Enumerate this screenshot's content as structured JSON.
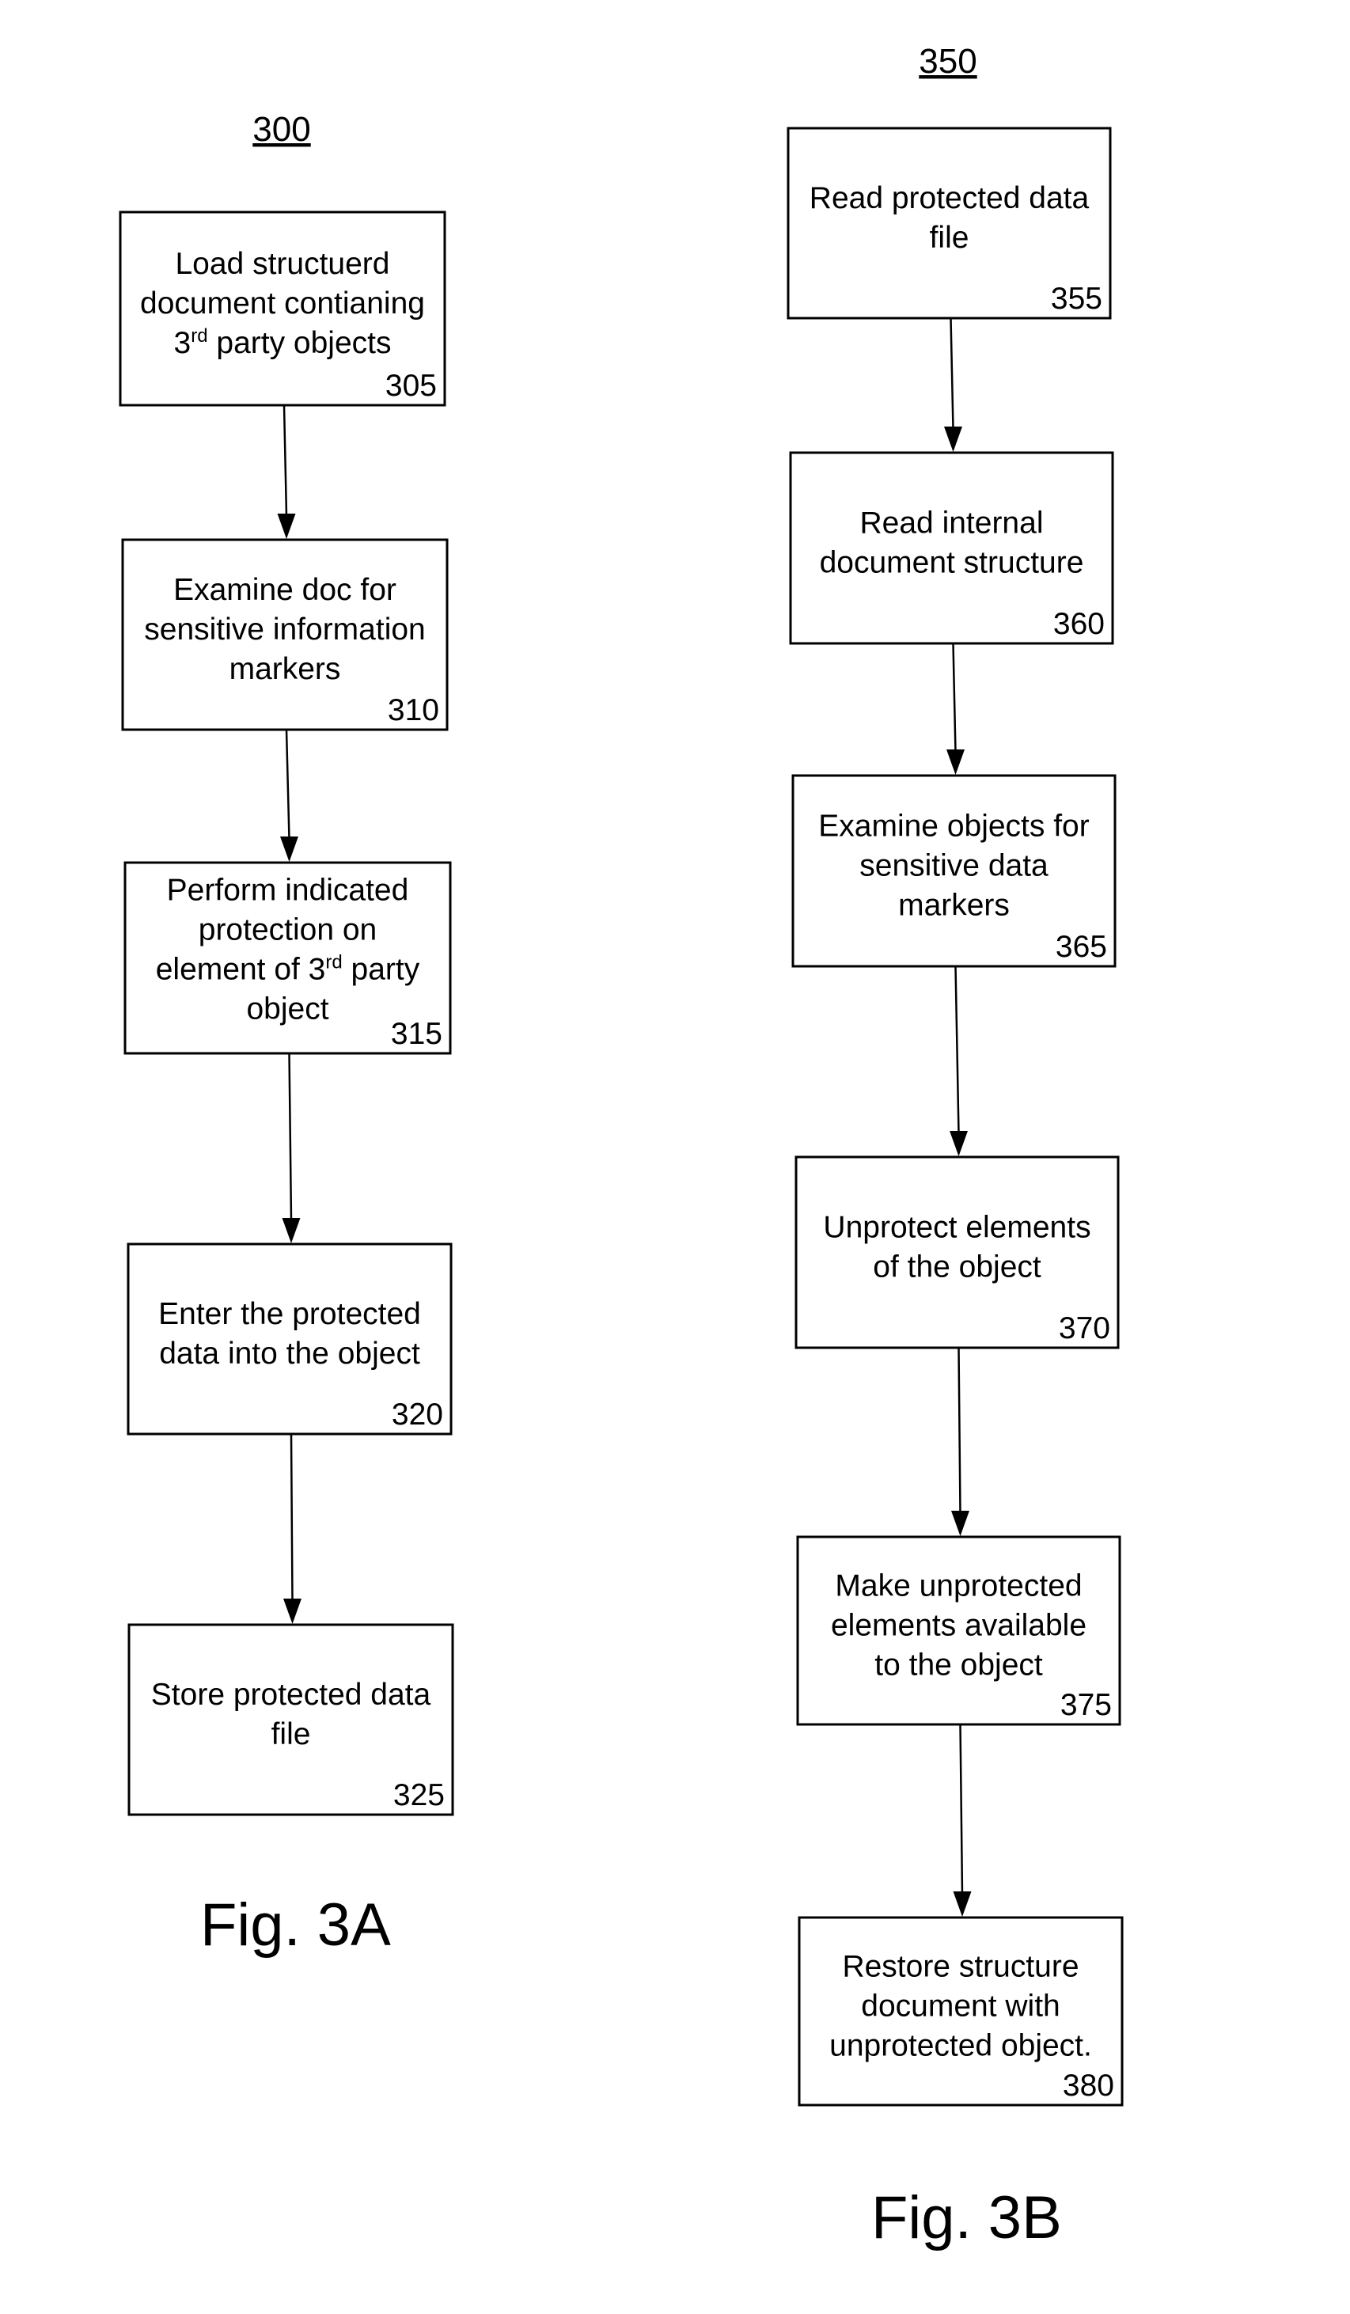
{
  "figures": [
    {
      "id": "fig3a",
      "ref_label": "300",
      "caption": "Fig. 3A",
      "steps": [
        {
          "lines": [
            [
              {
                "t": "Load structuerd"
              }
            ],
            [
              {
                "t": "document contianing"
              }
            ],
            [
              {
                "t": "3"
              },
              {
                "t": "rd",
                "sup": true
              },
              {
                "t": " party objects"
              }
            ]
          ],
          "ref": "305"
        },
        {
          "lines": [
            [
              {
                "t": "Examine doc for"
              }
            ],
            [
              {
                "t": "sensitive information"
              }
            ],
            [
              {
                "t": "markers"
              }
            ]
          ],
          "ref": "310"
        },
        {
          "lines": [
            [
              {
                "t": "Perform indicated"
              }
            ],
            [
              {
                "t": "protection on"
              }
            ],
            [
              {
                "t": "element of 3"
              },
              {
                "t": "rd",
                "sup": true
              },
              {
                "t": " party"
              }
            ],
            [
              {
                "t": "object"
              }
            ]
          ],
          "ref": "315"
        },
        {
          "lines": [
            [
              {
                "t": "Enter the protected"
              }
            ],
            [
              {
                "t": "data into the object"
              }
            ]
          ],
          "ref": "320"
        },
        {
          "lines": [
            [
              {
                "t": "Store protected data"
              }
            ],
            [
              {
                "t": "file"
              }
            ]
          ],
          "ref": "325"
        }
      ]
    },
    {
      "id": "fig3b",
      "ref_label": "350",
      "caption": "Fig. 3B",
      "steps": [
        {
          "lines": [
            [
              {
                "t": "Read protected data"
              }
            ],
            [
              {
                "t": "file"
              }
            ]
          ],
          "ref": "355"
        },
        {
          "lines": [
            [
              {
                "t": "Read internal"
              }
            ],
            [
              {
                "t": "document structure"
              }
            ]
          ],
          "ref": "360"
        },
        {
          "lines": [
            [
              {
                "t": "Examine objects for"
              }
            ],
            [
              {
                "t": "sensitive data"
              }
            ],
            [
              {
                "t": "markers"
              }
            ]
          ],
          "ref": "365"
        },
        {
          "lines": [
            [
              {
                "t": "Unprotect elements"
              }
            ],
            [
              {
                "t": "of the object"
              }
            ]
          ],
          "ref": "370"
        },
        {
          "lines": [
            [
              {
                "t": "Make unprotected"
              }
            ],
            [
              {
                "t": "elements available"
              }
            ],
            [
              {
                "t": "to the object"
              }
            ]
          ],
          "ref": "375"
        },
        {
          "lines": [
            [
              {
                "t": "Restore structure"
              }
            ],
            [
              {
                "t": "document with"
              }
            ],
            [
              {
                "t": "unprotected object."
              }
            ]
          ],
          "ref": "380"
        }
      ]
    }
  ]
}
